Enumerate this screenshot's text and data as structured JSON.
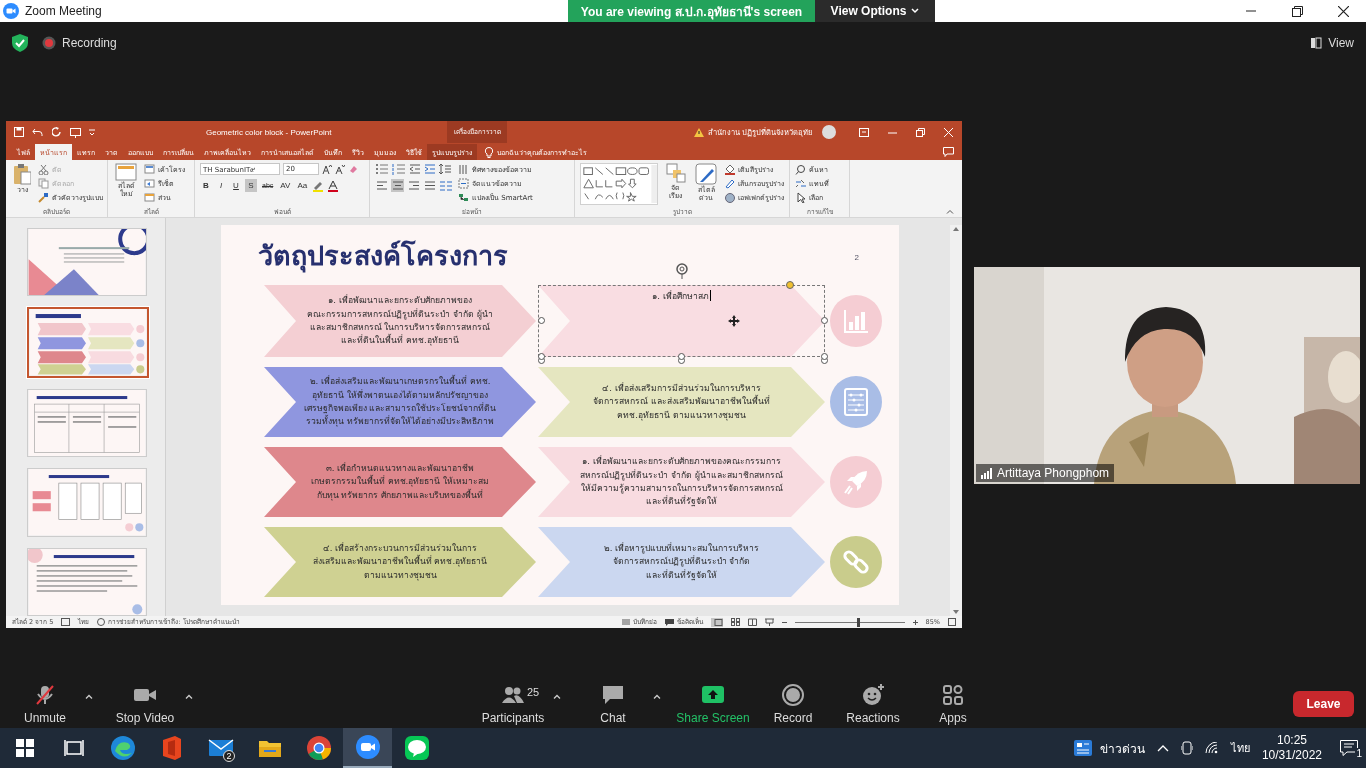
{
  "zoom_titlebar": {
    "title": "Zoom Meeting",
    "banner": "You are viewing ส.ป.ก.อุทัยธานี's screen",
    "view_options": "View Options"
  },
  "meeting_bar": {
    "recording": "Recording",
    "view": "View"
  },
  "powerpoint": {
    "title": "Geometric color block  -  PowerPoint",
    "context_group": "เครื่องมือการวาด",
    "account": "สำนักงาน ปฏิรูปที่ดินจังหวัดอุทัย",
    "tabs": [
      {
        "label": "ไฟล์",
        "selected": false
      },
      {
        "label": "หน้าแรก",
        "selected": true
      },
      {
        "label": "แทรก",
        "selected": false
      },
      {
        "label": "วาด",
        "selected": false
      },
      {
        "label": "ออกแบบ",
        "selected": false
      },
      {
        "label": "การเปลี่ยน",
        "selected": false
      },
      {
        "label": "ภาพเคลื่อนไหว",
        "selected": false
      },
      {
        "label": "การนำเสนอสไลด์",
        "selected": false
      },
      {
        "label": "บันทึก",
        "selected": false
      },
      {
        "label": "รีวิว",
        "selected": false
      },
      {
        "label": "มุมมอง",
        "selected": false
      },
      {
        "label": "วิธีใช้",
        "selected": false
      },
      {
        "label": "รูปแบบรูปร่าง",
        "selected": false
      }
    ],
    "tell_me": "บอกฉันว่าคุณต้องการทำอะไร",
    "ribbon": [
      {
        "kind": "clipboard",
        "label": "คลิปบอร์ด",
        "big": "วาง",
        "items": [
          {
            "label": "ตัด",
            "disabled": true
          },
          {
            "label": "คัดลอก",
            "disabled": true
          },
          {
            "label": "ตัวคัดวางรูปแบบ",
            "disabled": false
          }
        ]
      },
      {
        "kind": "slides",
        "label": "สไลด์",
        "big": "สไลด์\nใหม่",
        "items": [
          {
            "label": "เค้าโครง"
          },
          {
            "label": "รีเซ็ต"
          },
          {
            "label": "ส่วน"
          }
        ]
      },
      {
        "kind": "font",
        "label": "ฟอนต์",
        "font": "TH SarabunIT๙",
        "size": "20",
        "buttons": [
          {
            "label": "B",
            "selected": false
          },
          {
            "label": "I",
            "selected": false
          },
          {
            "label": "U",
            "selected": false
          },
          {
            "label": "S",
            "selected": true
          },
          {
            "label": "abc",
            "selected": false
          },
          {
            "label": "AV",
            "selected": false
          },
          {
            "label": "Aa",
            "selected": false
          }
        ]
      },
      {
        "kind": "paragraph",
        "label": "ย่อหน้า",
        "alignment": [
          {
            "selected": false
          },
          {
            "selected": true
          },
          {
            "selected": false
          },
          {
            "selected": false
          }
        ],
        "items": [
          {
            "label": "ทิศทางของข้อความ"
          },
          {
            "label": "จัดแนวข้อความ"
          },
          {
            "label": "แปลงเป็น SmartArt"
          }
        ]
      },
      {
        "kind": "drawing",
        "label": "รูปวาด",
        "bigs": [
          "จัดเรียง",
          "สไตล์\nด่วน"
        ],
        "items": [
          {
            "label": "เติมสีรูปร่าง"
          },
          {
            "label": "เส้นกรอบรูปร่าง"
          },
          {
            "label": "เอฟเฟกต์รูปร่าง"
          }
        ]
      },
      {
        "kind": "editing",
        "label": "การแก้ไข",
        "items": [
          {
            "label": "ค้นหา"
          },
          {
            "label": "แทนที่"
          },
          {
            "label": "เลือก"
          }
        ]
      }
    ],
    "thumbnails": [
      {
        "selected": false
      },
      {
        "selected": true
      },
      {
        "selected": false
      },
      {
        "selected": false
      },
      {
        "selected": false
      }
    ],
    "slide": {
      "title": "วัตถุประสงค์โครงการ",
      "page_number": "2",
      "rows": [
        {
          "left": {
            "text": "๑. เพื่อพัฒนาและยกระดับศักยภาพของ\nคณะกรรมการสหกรณ์ปฏิรูปที่ดินระบำ จำกัด ผู้นำ\nและสมาชิกสหกรณ์ ในการบริหารจัดการสหกรณ์\nและที่ดินในพื้นที่ คทช.อุทัยธานี",
            "color": "#f4cfd3",
            "selected": false
          },
          "right": {
            "text": "๑. เพื่อศึกษาสภ",
            "color": "#f9dde2",
            "selected": true
          },
          "badge": {
            "kind": "chart",
            "color": "#f5cdd3"
          }
        },
        {
          "left": {
            "text": "๒. เพื่อส่งเสริมและพัฒนาเกษตรกรในพื้นที่ คทช.\nอุทัยธานี ให้พึ่งพาตนเองได้ตามหลักปรัชญาของ\nเศรษฐกิจพอเพียง และสามารถใช้ประโยชน์จากที่ดิน\nรวมทั้งทุน ทรัพยากรที่จัดให้ได้อย่างมีประสิทธิภาพ",
            "color": "#8f96df",
            "selected": false
          },
          "right": {
            "text": "๔. เพื่อส่งเสริมการมีส่วนร่วมในการบริหาร\nจัดการสหกรณ์ และส่งเสริมพัฒนาอาชีพในพื้นที่\nคทช.อุทัยธานี ตามแนวทางชุมชน",
            "color": "#e5e6c0",
            "selected": false
          },
          "badge": {
            "kind": "abacus",
            "color": "#a9bde6"
          }
        },
        {
          "left": {
            "text": "๓. เพื่อกำหนดแนวทางและพัฒนาอาชีพ\nเกษตรกรรมในพื้นที่ คทช.อุทัยธานี ให้เหมาะสม\nกับทุน ทรัพยากร ศักยภาพและบริบทของพื้นที่",
            "color": "#de878c",
            "selected": false
          },
          "right": {
            "text": "๑. เพื่อพัฒนาและยกระดับศักยภาพของคณะกรรมการ\nสหกรณ์ปฏิรูปที่ดินระบำ จำกัด ผู้นำและสมาชิกสหกรณ์\nให้มีความรู้ความสามารถในการบริหารจัดการสหกรณ์\nและที่ดินที่รัฐจัดให้",
            "color": "#f8dbe0",
            "selected": false
          },
          "badge": {
            "kind": "rocket",
            "color": "#f5cdd3"
          }
        },
        {
          "left": {
            "text": "๔. เพื่อสร้างกระบวนการมีส่วนร่วมในการ\nส่งเสริมและพัฒนาอาชีพในพื้นที่ คทช.อุทัยธานี\nตามแนวทางชุมชน",
            "color": "#cfd192",
            "selected": false
          },
          "right": {
            "text": "๒. เพื่อหารูปแบบที่เหมาะสมในการบริหาร\nจัดการสหกรณ์ปฏิรูปที่ดินระบำ จำกัด\nและที่ดินที่รัฐจัดให้",
            "color": "#cbd7f0",
            "selected": false
          },
          "badge": {
            "kind": "link",
            "color": "#c9cc8c"
          }
        }
      ]
    },
    "status_bar": {
      "slide_count": "สไลด์ 2 จาก 5",
      "language": "ไทย",
      "accessibility": "การช่วยสำหรับการเข้าถึง: โปรดศึกษาคำแนะนำ",
      "notes": "บันทึกย่อ",
      "comments": "ข้อคิดเห็น",
      "zoom": "85%",
      "level": 0.58
    }
  },
  "video": {
    "kind": "picture",
    "name": "Artittaya Phongphom"
  },
  "controls": [
    {
      "label": "Unmute",
      "kind": "mic-off",
      "menu": true
    },
    {
      "label": "Stop Video",
      "kind": "camera",
      "menu": true
    },
    {
      "label": "Participants",
      "kind": "people",
      "count": "25",
      "menu": true
    },
    {
      "label": "Chat",
      "kind": "chat",
      "menu": true
    },
    {
      "label": "Share Screen",
      "kind": "share",
      "menu": false
    },
    {
      "label": "Record",
      "kind": "record",
      "menu": false
    },
    {
      "label": "Reactions",
      "kind": "reactions",
      "menu": false
    },
    {
      "label": "Apps",
      "kind": "apps",
      "menu": false
    }
  ],
  "leave": "Leave",
  "taskbar": {
    "apps": [
      {
        "kind": "start",
        "selected": false
      },
      {
        "kind": "task-view",
        "selected": false
      },
      {
        "kind": "edge",
        "selected": false
      },
      {
        "kind": "office",
        "selected": false
      },
      {
        "kind": "mail",
        "badge": "2",
        "selected": false
      },
      {
        "kind": "explorer",
        "selected": false
      },
      {
        "kind": "chrome",
        "selected": false
      },
      {
        "kind": "zoom",
        "selected": true
      },
      {
        "kind": "line",
        "selected": false
      }
    ],
    "news": "ข่าวด่วน",
    "language": "ไทย",
    "time": "10:25",
    "date": "10/31/2022",
    "notifications": "1"
  }
}
